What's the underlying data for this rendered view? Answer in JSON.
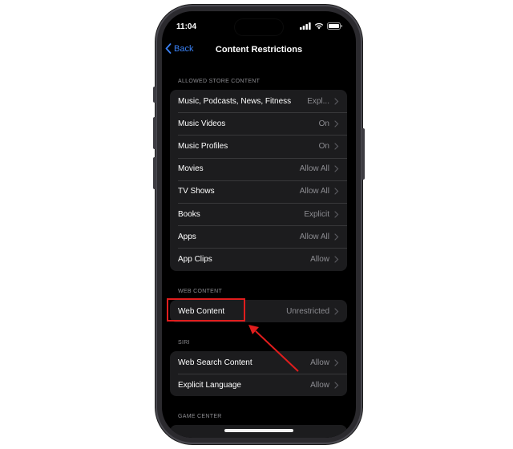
{
  "status": {
    "time": "11:04"
  },
  "nav": {
    "back_label": "Back",
    "title": "Content Restrictions"
  },
  "sections": {
    "store": {
      "header": "ALLOWED STORE CONTENT",
      "rows": [
        {
          "label": "Music, Podcasts, News, Fitness",
          "value": "Expl..."
        },
        {
          "label": "Music Videos",
          "value": "On"
        },
        {
          "label": "Music Profiles",
          "value": "On"
        },
        {
          "label": "Movies",
          "value": "Allow All"
        },
        {
          "label": "TV Shows",
          "value": "Allow All"
        },
        {
          "label": "Books",
          "value": "Explicit"
        },
        {
          "label": "Apps",
          "value": "Allow All"
        },
        {
          "label": "App Clips",
          "value": "Allow"
        }
      ]
    },
    "web": {
      "header": "WEB CONTENT",
      "rows": [
        {
          "label": "Web Content",
          "value": "Unrestricted"
        }
      ]
    },
    "siri": {
      "header": "SIRI",
      "rows": [
        {
          "label": "Web Search Content",
          "value": "Allow"
        },
        {
          "label": "Explicit Language",
          "value": "Allow"
        }
      ]
    },
    "game": {
      "header": "GAME CENTER"
    }
  },
  "annotation": {
    "color": "#e11d1d"
  },
  "icons": {
    "back": "chevron-left-icon",
    "disclosure": "chevron-right-icon",
    "signal": "signal-icon",
    "wifi": "wifi-icon",
    "battery": "battery-icon"
  }
}
